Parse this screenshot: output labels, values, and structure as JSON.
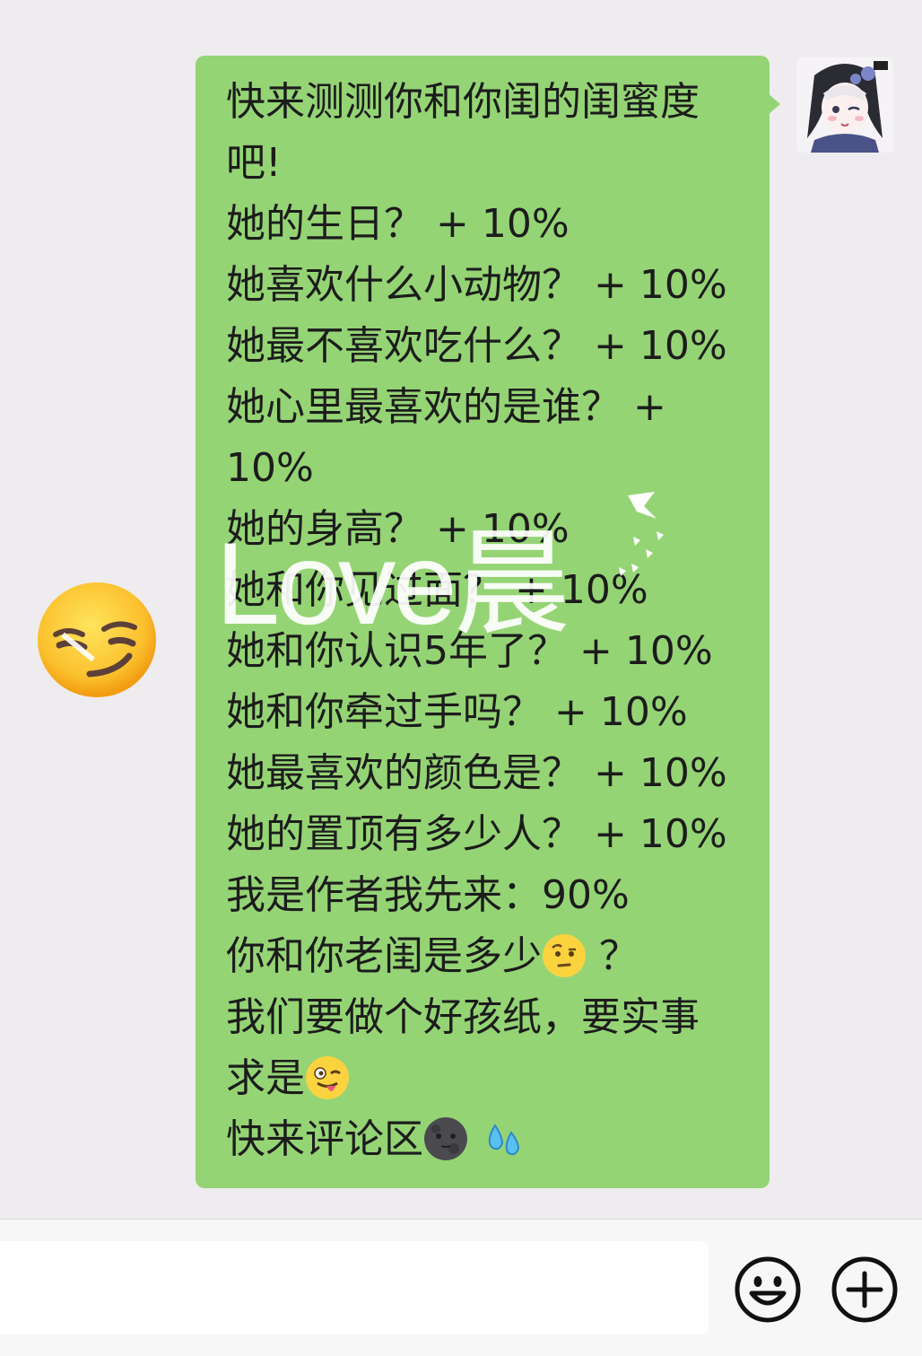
{
  "chat": {
    "side_emoji": "smirk-face-emoji",
    "avatar": "anime-girl-avatar",
    "message": {
      "lines": [
        {
          "text": "快来测测你和你闺的闺蜜度"
        },
        {
          "text": "吧!"
        },
        {
          "text": "她的生日？ + 10%"
        },
        {
          "text": "她喜欢什么小动物？ + 10%"
        },
        {
          "text": "她最不喜欢吃什么？ + 10%"
        },
        {
          "text": "她心里最喜欢的是谁？ +"
        },
        {
          "text": "10%"
        },
        {
          "text": "她的身高？ + 10%"
        },
        {
          "text": "她和你见过面？ + 10%"
        },
        {
          "text": "她和你认识5年了？ + 10%"
        },
        {
          "text": "她和你牵过手吗？ + 10%"
        },
        {
          "text": "她最喜欢的颜色是？ + 10%"
        },
        {
          "text": "她的置顶有多少人？ + 10%"
        },
        {
          "text": "我是作者我先来：90%"
        },
        {
          "text": "你和你老闺是多少",
          "emoji": "raised-eyebrow-emoji",
          "after": " ？"
        },
        {
          "text": "我们要做个好孩纸，要实事"
        },
        {
          "text": "求是",
          "emoji": "winking-tongue-emoji"
        },
        {
          "text": "快来评论区",
          "emoji": "new-moon-face-emoji",
          "emoji2": "sweat-droplets-emoji"
        }
      ]
    },
    "watermark": "Love晨"
  },
  "input_bar": {
    "input_value": "",
    "emoji_button": "emoji-icon",
    "plus_button": "plus-icon"
  },
  "colors": {
    "bubble": "#95D475",
    "chat_bg": "#EEECEE",
    "input_bar_bg": "#F7F7F7"
  }
}
